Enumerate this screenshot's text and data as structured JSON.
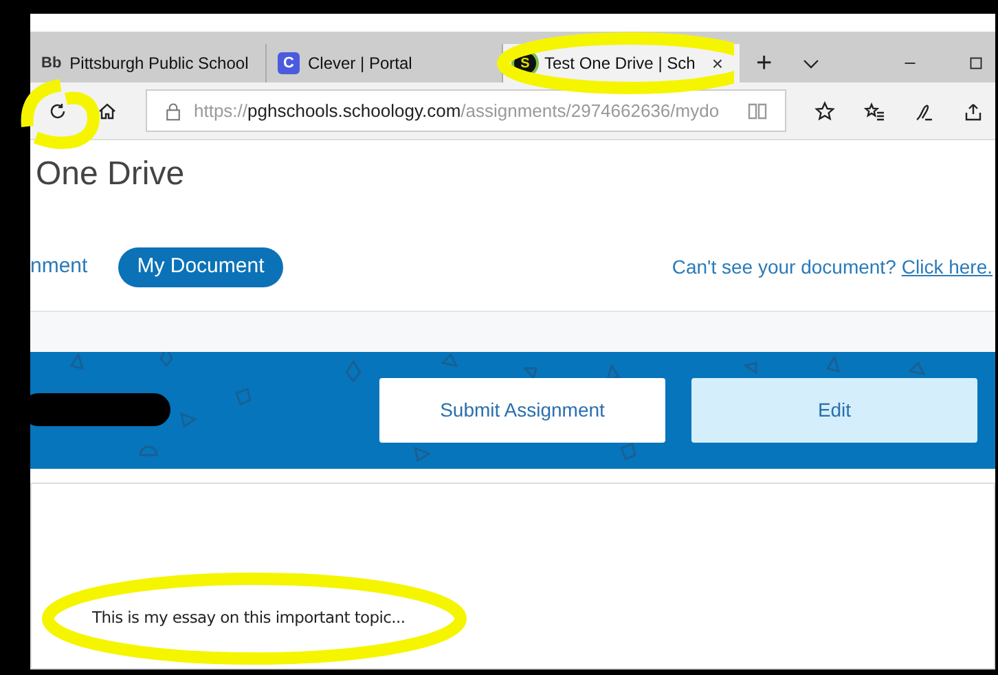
{
  "browser": {
    "tabs": [
      {
        "icon": "Bb",
        "label": "Pittsburgh Public School",
        "selected": false,
        "kind": "text-icon"
      },
      {
        "icon": "C",
        "label": "Clever | Portal",
        "selected": false,
        "kind": "letter-badge"
      },
      {
        "icon": "S",
        "label": "Test One Drive | Sch",
        "selected": true,
        "kind": "circle-badge",
        "close": "×"
      }
    ],
    "new_tab": "+",
    "address": {
      "scheme": "https://",
      "host": "pghschools.schoology.com",
      "path": "/assignments/2974662636/mydo"
    }
  },
  "page": {
    "title": "One Drive",
    "tabs": [
      {
        "label": "nment",
        "selected": false
      },
      {
        "label": "My Document",
        "selected": true
      }
    ],
    "help": {
      "text": "Can't see your document?",
      "link": "Click here."
    },
    "actions": [
      {
        "label": "Submit Assignment",
        "kind": "primary"
      },
      {
        "label": "Edit",
        "kind": "secondary"
      }
    ],
    "document": {
      "text": "This is my essay on this important topic..."
    }
  }
}
